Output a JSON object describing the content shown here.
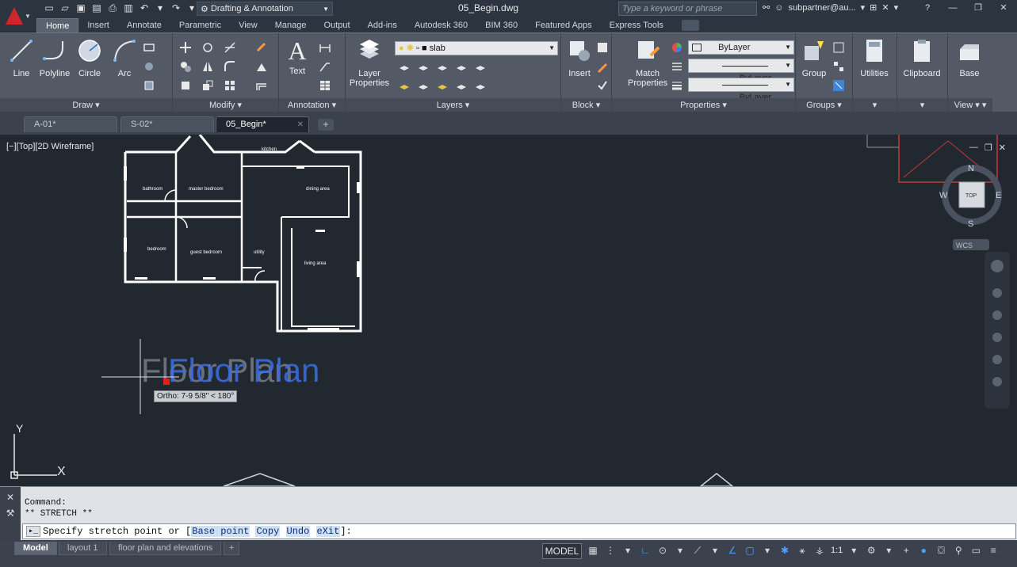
{
  "titlebar": {
    "workspace": "Drafting & Annotation",
    "document": "05_Begin.dwg",
    "search_placeholder": "Type a keyword or phrase",
    "user": "subpartner@au..."
  },
  "ribbon_tabs": [
    "Home",
    "Insert",
    "Annotate",
    "Parametric",
    "View",
    "Manage",
    "Output",
    "Add-ins",
    "Autodesk 360",
    "BIM 360",
    "Featured Apps",
    "Express Tools"
  ],
  "ribbon": {
    "draw": {
      "label": "Draw",
      "tools": [
        "Line",
        "Polyline",
        "Circle",
        "Arc"
      ]
    },
    "modify": {
      "label": "Modify"
    },
    "annotation": {
      "label": "Annotation",
      "text_tool": "Text"
    },
    "layers": {
      "label": "Layers",
      "layer_properties_1": "Layer",
      "layer_properties_2": "Properties",
      "current_layer": "slab"
    },
    "block": {
      "label": "Block",
      "insert": "Insert"
    },
    "properties": {
      "label": "Properties",
      "match_1": "Match",
      "match_2": "Properties",
      "color": "ByLayer",
      "linetype": "ByLayer",
      "lineweight": "ByLayer"
    },
    "groups": {
      "label": "Groups",
      "group": "Group"
    },
    "utilities": {
      "label": "Utilities"
    },
    "clipboard": {
      "label": "Clipboard"
    },
    "view": {
      "label": "View",
      "base": "Base"
    }
  },
  "file_tabs": [
    {
      "name": "A-01*",
      "active": false
    },
    {
      "name": "S-02*",
      "active": false
    },
    {
      "name": "05_Begin*",
      "active": true
    }
  ],
  "viewport": {
    "label": "[−][Top][2D Wireframe]",
    "ortho_tooltip": "Ortho: 7-9 5/8\" < 180°",
    "floor_plan_text": "Floor Plan",
    "room_labels": [
      "bathroom",
      "master bedroom",
      "kitchen",
      "dining area",
      "bedroom",
      "guest bedroom",
      "utility",
      "living area"
    ],
    "viewcube": {
      "top": "TOP",
      "n": "N",
      "s": "S",
      "e": "E",
      "w": "W",
      "wcs": "WCS"
    },
    "ucs": {
      "x": "X",
      "y": "Y"
    }
  },
  "command": {
    "history_1": "Command:",
    "history_2": "** STRETCH **",
    "prompt": "Specify stretch point or [",
    "options": [
      "Base point",
      "Copy",
      "Undo",
      "eXit"
    ],
    "prompt_end": "]:"
  },
  "status": {
    "layout_tabs": [
      "Model",
      "layout 1",
      "floor plan and elevations"
    ],
    "model_button": "MODEL",
    "scale": "1:1"
  }
}
